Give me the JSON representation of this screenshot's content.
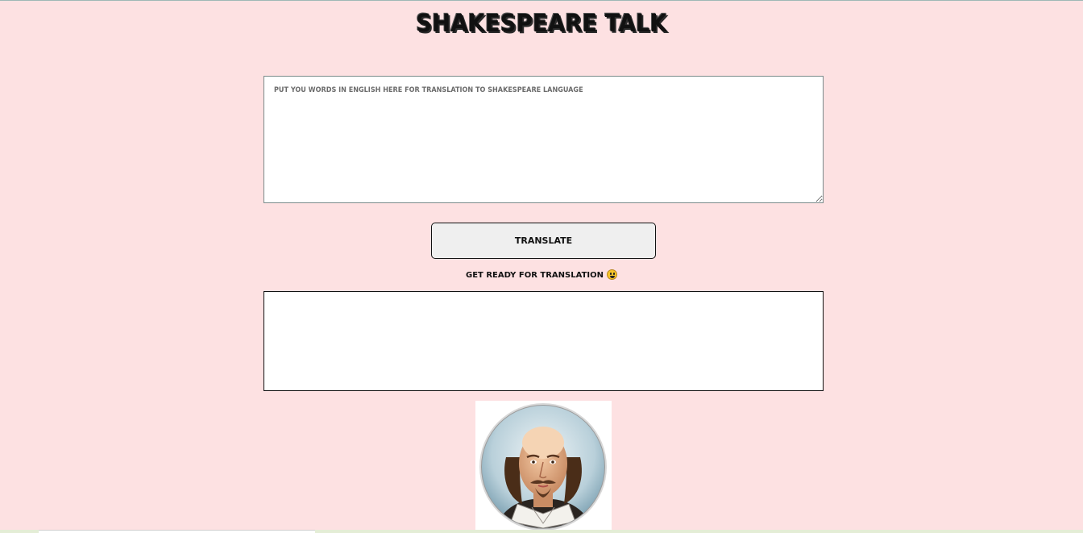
{
  "app": {
    "title": "Shakespeare Talk"
  },
  "input": {
    "placeholder": "Put you words in english here for translation to shakespeare language",
    "value": ""
  },
  "translate_button": {
    "label": "Translate"
  },
  "status": {
    "text": "Get ready for translation",
    "emoji_icon": "smiley-face-icon"
  },
  "output": {
    "text": ""
  },
  "portrait": {
    "icon": "shakespeare-portrait"
  },
  "colors": {
    "background": "#fde1e2",
    "button_bg": "#efefef"
  }
}
